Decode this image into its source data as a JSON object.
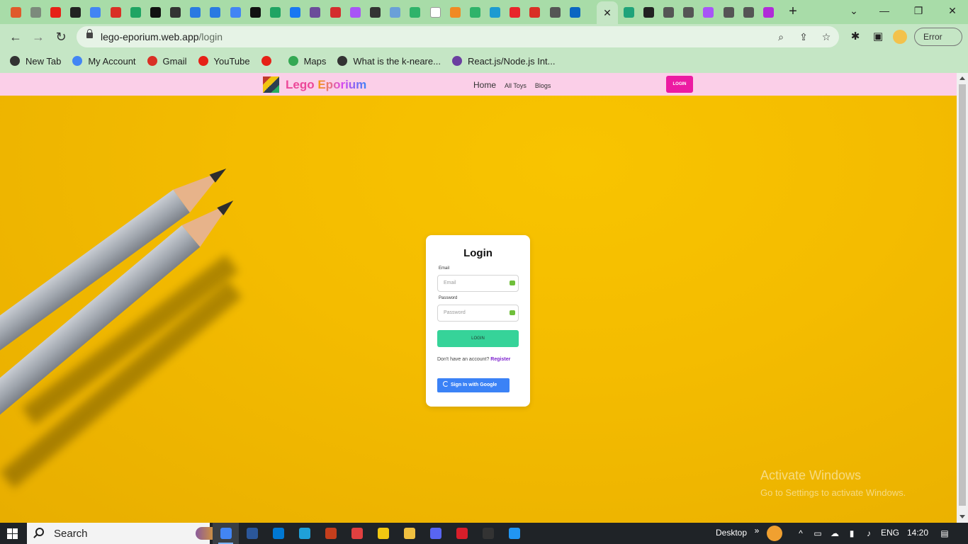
{
  "browser": {
    "tab_icons": [
      {
        "name": "tab-icon-1",
        "color": "#e05a2b"
      },
      {
        "name": "tab-icon-chatgpt",
        "color": "#7c8a7c"
      },
      {
        "name": "tab-icon-youtube",
        "color": "#e62117"
      },
      {
        "name": "tab-icon-github",
        "color": "#222222"
      },
      {
        "name": "tab-icon-google",
        "color": "#4285f4"
      },
      {
        "name": "tab-icon-gmail",
        "color": "#d93025"
      },
      {
        "name": "tab-icon-drive",
        "color": "#1fa463"
      },
      {
        "name": "tab-icon-codeforces",
        "color": "#111111"
      },
      {
        "name": "tab-icon-chrome-1",
        "color": "#333333"
      },
      {
        "name": "tab-icon-ibb-1",
        "color": "#2a7ae2"
      },
      {
        "name": "tab-icon-ibb-2",
        "color": "#2a7ae2"
      },
      {
        "name": "tab-icon-google-2",
        "color": "#4285f4"
      },
      {
        "name": "tab-icon-codeforces-2",
        "color": "#111111"
      },
      {
        "name": "tab-icon-drive-2",
        "color": "#1fa463"
      },
      {
        "name": "tab-icon-facebook",
        "color": "#1877f2"
      },
      {
        "name": "tab-icon-pattern",
        "color": "#6b4c9a"
      },
      {
        "name": "tab-icon-netlify",
        "color": "#d42d2d"
      },
      {
        "name": "tab-icon-vite",
        "color": "#a855f7"
      },
      {
        "name": "tab-icon-chrome-2",
        "color": "#333333"
      },
      {
        "name": "tab-icon-bottle",
        "color": "#6aa0d8"
      },
      {
        "name": "tab-icon-c-green",
        "color": "#2fb36a"
      },
      {
        "name": "tab-icon-w",
        "color": "#ffffff"
      },
      {
        "name": "tab-icon-orange",
        "color": "#f08a24"
      },
      {
        "name": "tab-icon-c-green-2",
        "color": "#2fb36a"
      },
      {
        "name": "tab-icon-is",
        "color": "#1d9bd1"
      },
      {
        "name": "tab-icon-red-circle",
        "color": "#e8262b"
      },
      {
        "name": "tab-icon-gmail-2",
        "color": "#d93025"
      },
      {
        "name": "tab-icon-chrome-3",
        "color": "#555555"
      },
      {
        "name": "tab-icon-linkedin",
        "color": "#0a66c2"
      }
    ],
    "tab_icons_right": [
      {
        "name": "tab-icon-lego",
        "color": "#1fa37a"
      },
      {
        "name": "tab-icon-github-2",
        "color": "#222222"
      },
      {
        "name": "tab-icon-chrome-4",
        "color": "#555555"
      },
      {
        "name": "tab-icon-chrome-5",
        "color": "#555555"
      },
      {
        "name": "tab-icon-vite-2",
        "color": "#a855f7"
      },
      {
        "name": "tab-icon-chrome-6",
        "color": "#555555"
      },
      {
        "name": "tab-icon-chrome-7",
        "color": "#555555"
      },
      {
        "name": "tab-icon-purple",
        "color": "#b02cd8"
      }
    ],
    "url_host": "lego-eporium.web.app",
    "url_path": "/login",
    "error_label": "Error"
  },
  "bookmarks": [
    {
      "label": "New Tab",
      "color": "#333333"
    },
    {
      "label": "My Account",
      "color": "#4285f4"
    },
    {
      "label": "Gmail",
      "color": "#d93025"
    },
    {
      "label": "YouTube",
      "color": "#e62117"
    },
    {
      "label": "",
      "color": "#e62117"
    },
    {
      "label": "Maps",
      "color": "#34a853"
    },
    {
      "label": "What is the k-neare...",
      "color": "#333333"
    },
    {
      "label": "React.js/Node.js Int...",
      "color": "#6b3fa0"
    }
  ],
  "site": {
    "brand_first": "Lego",
    "brand_second": "Eporium",
    "nav": {
      "home": "Home",
      "all_toys": "All Toys",
      "blogs": "Blogs"
    },
    "login_button": "LOGIN",
    "accent_pink": "#ec1ba2",
    "navbar_color": "#fbcfe8"
  },
  "login_card": {
    "title": "Login",
    "email_label": "Email",
    "email_placeholder": "Email",
    "password_label": "Password",
    "password_placeholder": "Password",
    "submit_label": "LOGIN",
    "no_account_text": "Don't have an account?",
    "register_link": "Register",
    "google_label": "Sign In with Google"
  },
  "watermark": {
    "line1": "Activate Windows",
    "line2": "Go to Settings to activate Windows."
  },
  "taskbar": {
    "search_label": "Search",
    "apps": [
      {
        "name": "chrome",
        "color": "#4285f4",
        "active": true
      },
      {
        "name": "word",
        "color": "#2b579a"
      },
      {
        "name": "mail",
        "color": "#0078d4"
      },
      {
        "name": "edge",
        "color": "#1fa0d8"
      },
      {
        "name": "powerpoint",
        "color": "#c43e1c"
      },
      {
        "name": "app-swirl",
        "color": "#e04040"
      },
      {
        "name": "store",
        "color": "#f2c811"
      },
      {
        "name": "file-explorer",
        "color": "#f0c040"
      },
      {
        "name": "discord",
        "color": "#5865f2"
      },
      {
        "name": "shield",
        "color": "#d81e2a"
      },
      {
        "name": "terminal",
        "color": "#333333"
      },
      {
        "name": "vscode",
        "color": "#2196f3"
      }
    ],
    "desktop_label": "Desktop",
    "language": "ENG",
    "time": "14:20"
  }
}
